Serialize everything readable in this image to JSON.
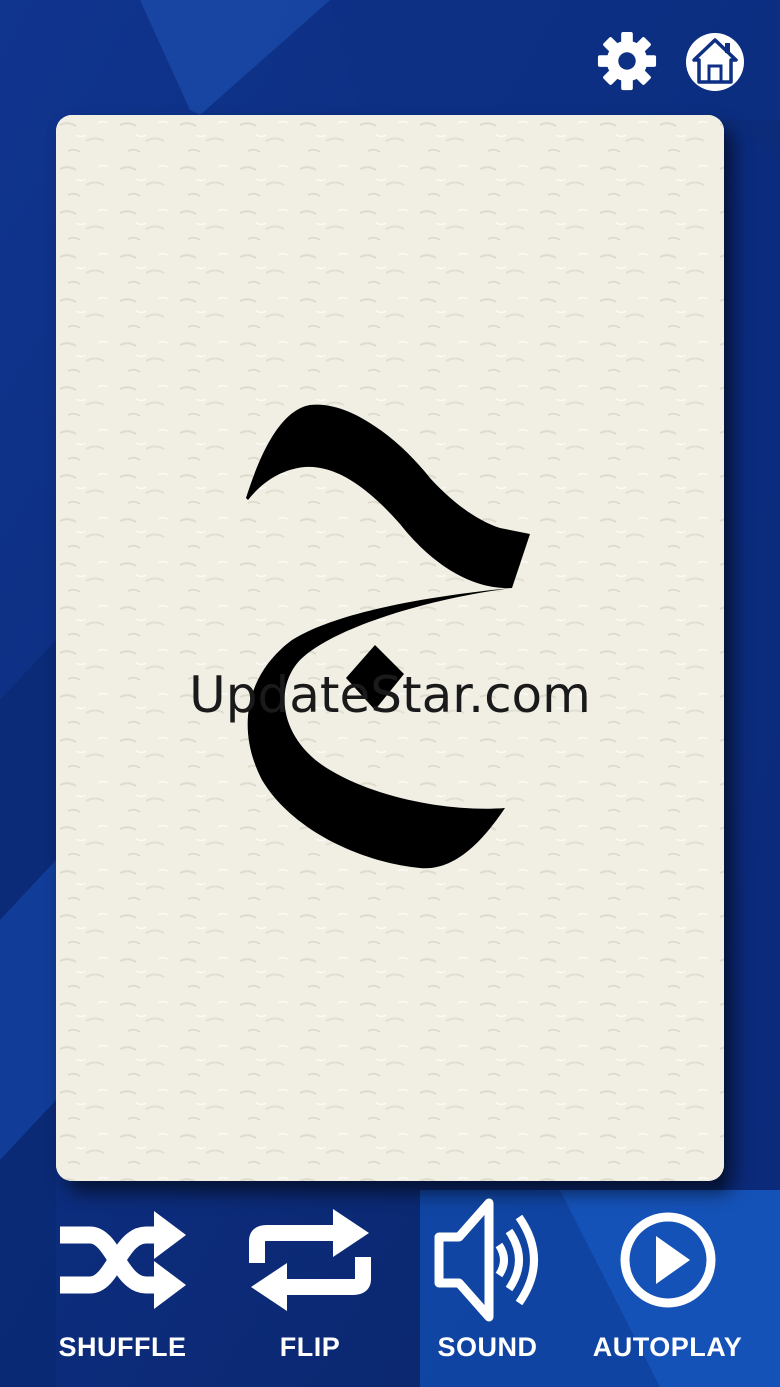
{
  "card": {
    "letter": "ج",
    "watermark": "UpdateStar.com"
  },
  "header": {
    "settings_icon": "gear-icon",
    "home_icon": "home-icon"
  },
  "toolbar": {
    "shuffle_label": "SHUFFLE",
    "flip_label": "FLIP",
    "sound_label": "SOUND",
    "autoplay_label": "AUTOPLAY"
  },
  "colors": {
    "background": "#0b2a78",
    "card": "#f1efe4",
    "icon": "#ffffff",
    "glyph": "#000000"
  }
}
